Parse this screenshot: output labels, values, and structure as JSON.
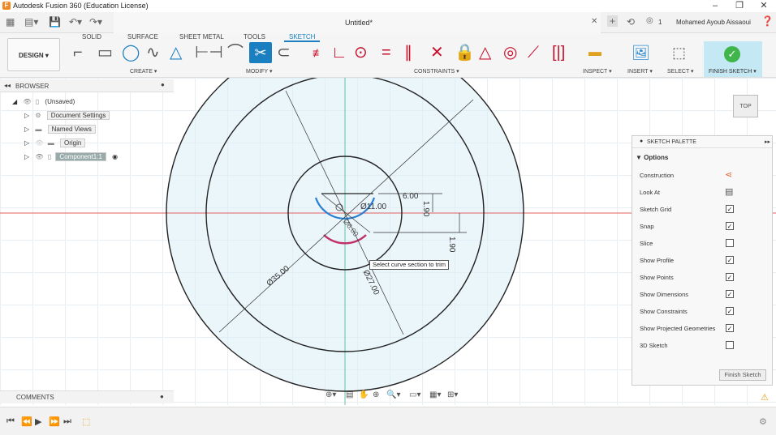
{
  "app": {
    "window_title": "Autodesk Fusion 360 (Education License)",
    "doc_title": "Untitled*",
    "user_name": "Mohamed Ayoub Aissaoui",
    "notification_count": "1"
  },
  "ribbon": {
    "tabs": [
      "SOLID",
      "SURFACE",
      "SHEET METAL",
      "TOOLS",
      "SKETCH"
    ],
    "active_tab": "SKETCH",
    "workspace_label": "DESIGN ▾",
    "groups": {
      "create": "CREATE ▾",
      "modify": "MODIFY ▾",
      "constraints": "CONSTRAINTS ▾",
      "inspect": "INSPECT ▾",
      "insert": "INSERT ▾",
      "select": "SELECT ▾",
      "finish": "FINISH SKETCH ▾"
    }
  },
  "browser": {
    "title": "BROWSER",
    "items": [
      {
        "label": "(Unsaved)"
      },
      {
        "label": "Document Settings"
      },
      {
        "label": "Named Views"
      },
      {
        "label": "Origin"
      },
      {
        "label": "Component1:1"
      }
    ]
  },
  "comments": {
    "title": "COMMENTS"
  },
  "palette": {
    "title": "SKETCH PALETTE",
    "section": "▼ Options",
    "rows": [
      {
        "label": "Construction",
        "type": "icon"
      },
      {
        "label": "Look At",
        "type": "icon"
      },
      {
        "label": "Sketch Grid",
        "type": "check",
        "checked": true
      },
      {
        "label": "Snap",
        "type": "check",
        "checked": true
      },
      {
        "label": "Slice",
        "type": "check",
        "checked": false
      },
      {
        "label": "Show Profile",
        "type": "check",
        "checked": true
      },
      {
        "label": "Show Points",
        "type": "check",
        "checked": true
      },
      {
        "label": "Show Dimensions",
        "type": "check",
        "checked": true
      },
      {
        "label": "Show Constraints",
        "type": "check",
        "checked": true
      },
      {
        "label": "Show Projected Geometries",
        "type": "check",
        "checked": true
      },
      {
        "label": "3D Sketch",
        "type": "check",
        "checked": false
      }
    ],
    "finish_button": "Finish Sketch"
  },
  "viewcube": {
    "face": "TOP"
  },
  "sketch": {
    "dimensions": {
      "outer": "Ø35.00",
      "middle": "Ø27.00",
      "inner": "Ø11.00",
      "small": "Ø6.00",
      "width": "6.00",
      "h1": "1.90",
      "h2": "1.90"
    },
    "tooltip": "Select curve section to trim"
  },
  "colors": {
    "accent": "#1a7fc1",
    "profile_fill": "#dbeef8",
    "sketch_line": "#222222",
    "trim_highlight": "#c0306a",
    "axis_x": "#e06060",
    "axis_y": "#60c0a0"
  }
}
